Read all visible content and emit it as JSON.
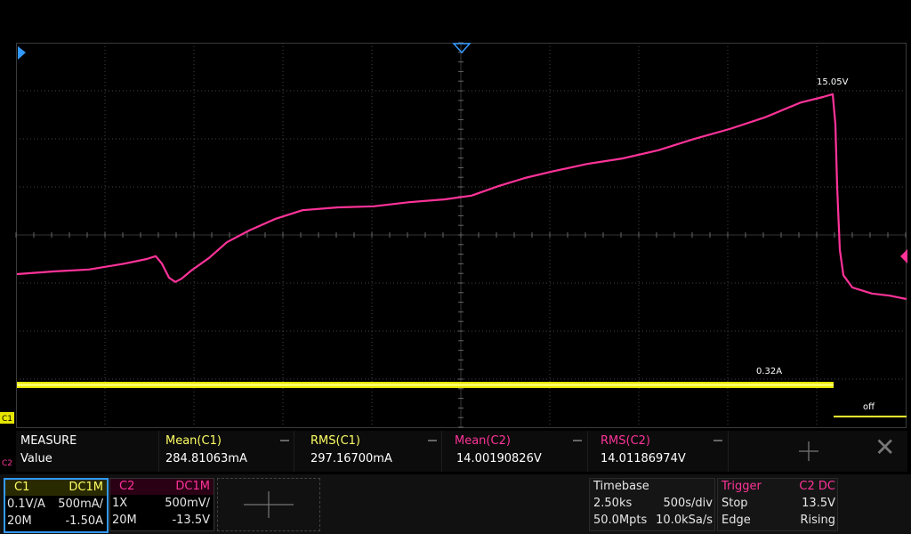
{
  "colors": {
    "c1": "#ffff33",
    "c2": "#ff3399",
    "accent": "#3399ff",
    "grid": "#555555"
  },
  "markers": {
    "trigger_position": "trigger-marker-icon",
    "c1_marker": "C1",
    "c2_marker": "C2",
    "left_marker": "left-marker-icon"
  },
  "waveform": {
    "c2_peak_label": "15.05V",
    "c1_level_label": "0.32A",
    "c1_off_label": "off"
  },
  "measure": {
    "title": "MEASURE",
    "row_label": "Value",
    "columns": [
      {
        "name": "Mean(C1)",
        "value": "284.81063mA",
        "color": "#ffff66"
      },
      {
        "name": "RMS(C1)",
        "value": "297.16700mA",
        "color": "#ffff66"
      },
      {
        "name": "Mean(C2)",
        "value": "14.00190826V",
        "color": "#ff3399"
      },
      {
        "name": "RMS(C2)",
        "value": "14.01186974V",
        "color": "#ff3399"
      }
    ]
  },
  "channels": {
    "c1": {
      "name": "C1",
      "coupling": "DC1M",
      "probe": "0.1V/A",
      "scale": "500mA/",
      "bw": "20M",
      "offset": "-1.50A"
    },
    "c2": {
      "name": "C2",
      "coupling": "DC1M",
      "probe": "1X",
      "scale": "500mV/",
      "bw": "20M",
      "offset": "-13.5V"
    }
  },
  "timebase": {
    "title": "Timebase",
    "delay": "2.50ks",
    "scale": "500s/div",
    "memory": "50.0Mpts",
    "rate": "10.0kSa/s"
  },
  "trigger": {
    "title": "Trigger",
    "source": "C2 DC",
    "mode": "Stop",
    "level": "13.5V",
    "type": "Edge",
    "slope": "Rising"
  }
}
